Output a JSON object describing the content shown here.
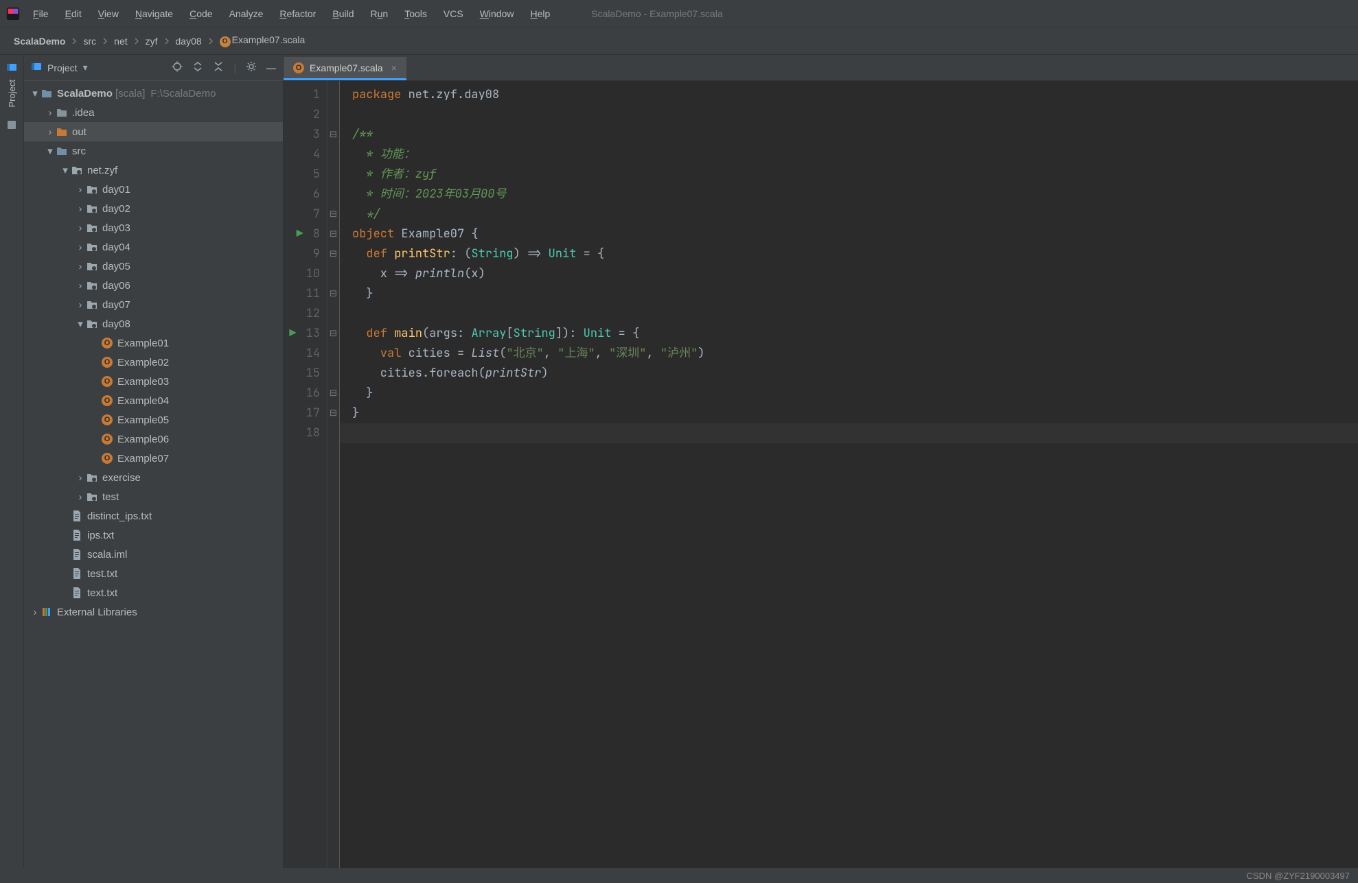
{
  "menu": {
    "items": [
      "File",
      "Edit",
      "View",
      "Navigate",
      "Code",
      "Analyze",
      "Refactor",
      "Build",
      "Run",
      "Tools",
      "VCS",
      "Window",
      "Help"
    ],
    "underlines": [
      "F",
      "E",
      "V",
      "N",
      "C",
      "",
      "R",
      "B",
      "u",
      "T",
      "",
      "W",
      "H"
    ]
  },
  "window_title": "ScalaDemo - Example07.scala",
  "breadcrumb": [
    "ScalaDemo",
    "src",
    "net",
    "zyf",
    "day08",
    "Example07.scala"
  ],
  "sidebar_label": "Project",
  "panel": {
    "title": "Project"
  },
  "tree": {
    "root": {
      "label": "ScalaDemo",
      "tag": "[scala]",
      "path": "F:\\ScalaDemo"
    },
    "idea": ".idea",
    "out": "out",
    "src": "src",
    "pkg": "net.zyf",
    "days": [
      "day01",
      "day02",
      "day03",
      "day04",
      "day05",
      "day06",
      "day07",
      "day08"
    ],
    "examples": [
      "Example01",
      "Example02",
      "Example03",
      "Example04",
      "Example05",
      "Example06",
      "Example07"
    ],
    "exercise": "exercise",
    "test": "test",
    "files": [
      "distinct_ips.txt",
      "ips.txt",
      "scala.iml",
      "test.txt",
      "text.txt"
    ],
    "extlib": "External Libraries"
  },
  "tab": {
    "name": "Example07.scala"
  },
  "code": {
    "lines": [
      {
        "n": 1,
        "fold": "",
        "run": "",
        "html": "<span class='k-orange'>package</span> net.zyf.day08"
      },
      {
        "n": 2,
        "fold": "",
        "run": "",
        "html": ""
      },
      {
        "n": 3,
        "fold": "⊟",
        "run": "",
        "html": "<span class='k-green'>/**</span>"
      },
      {
        "n": 4,
        "fold": "",
        "run": "",
        "html": "<span class='k-green'>  * 功能：</span>"
      },
      {
        "n": 5,
        "fold": "",
        "run": "",
        "html": "<span class='k-green'>  * 作者：zyf</span>"
      },
      {
        "n": 6,
        "fold": "",
        "run": "",
        "html": "<span class='k-green'>  * 时间：2023年03月00号</span>"
      },
      {
        "n": 7,
        "fold": "⊟",
        "run": "",
        "html": "<span class='k-green'>  */</span>"
      },
      {
        "n": 8,
        "fold": "⊟",
        "run": "▶",
        "html": "<span class='k-orange'>object</span> Example07 {"
      },
      {
        "n": 9,
        "fold": "⊟",
        "run": "",
        "html": "  <span class='k-orange'>def</span> <span class='k-yellow'>printStr</span>: (<span class='k-teal'>String</span>) =&gt; <span class='k-teal'>Unit</span> = {"
      },
      {
        "n": 10,
        "fold": "",
        "run": "",
        "html": "    x =&gt; <span class='k-ital'>println</span>(x)"
      },
      {
        "n": 11,
        "fold": "⊟",
        "run": "",
        "html": "  }"
      },
      {
        "n": 12,
        "fold": "",
        "run": "",
        "html": ""
      },
      {
        "n": 13,
        "fold": "⊟",
        "run": "▶",
        "html": "  <span class='k-orange'>def</span> <span class='k-yellow'>main</span>(args: <span class='k-teal'>Array</span>[<span class='k-teal'>String</span>]): <span class='k-teal'>Unit</span> = {"
      },
      {
        "n": 14,
        "fold": "",
        "run": "",
        "html": "    <span class='k-orange'>val</span> cities = <span class='k-ital'>List</span>(<span class='k-str'>\"北京\"</span>, <span class='k-str'>\"上海\"</span>, <span class='k-str'>\"深圳\"</span>, <span class='k-str'>\"泸州\"</span>)"
      },
      {
        "n": 15,
        "fold": "",
        "run": "",
        "html": "    cities.foreach(<span class='k-ital'>printStr</span>)"
      },
      {
        "n": 16,
        "fold": "⊟",
        "run": "",
        "html": "  }"
      },
      {
        "n": 17,
        "fold": "⊟",
        "run": "",
        "html": "}"
      },
      {
        "n": 18,
        "fold": "",
        "run": "",
        "html": ""
      }
    ],
    "caret_line": 18
  },
  "footer": "CSDN @ZYF2190003497"
}
